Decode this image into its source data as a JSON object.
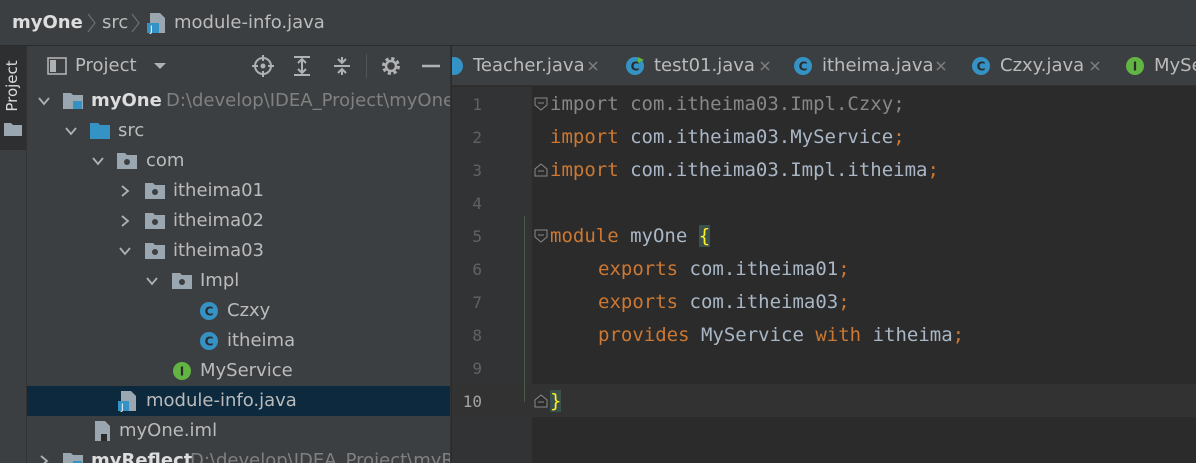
{
  "breadcrumb": {
    "project": "myOne",
    "folder": "src",
    "file": "module-info.java"
  },
  "toolstrip": {
    "project_label": "Project"
  },
  "panel": {
    "title": "Project"
  },
  "tree": [
    {
      "label": "myOne",
      "path": "D:\\develop\\IDEA_Project\\myOne",
      "icon": "module-folder-icon"
    },
    {
      "label": "src",
      "icon": "source-folder-icon"
    },
    {
      "label": "com",
      "icon": "package-icon"
    },
    {
      "label": "itheima01",
      "icon": "package-icon"
    },
    {
      "label": "itheima02",
      "icon": "package-icon"
    },
    {
      "label": "itheima03",
      "icon": "package-icon"
    },
    {
      "label": "Impl",
      "icon": "package-icon"
    },
    {
      "label": "Czxy",
      "icon": "class-icon"
    },
    {
      "label": "itheima",
      "icon": "class-icon"
    },
    {
      "label": "MyService",
      "icon": "interface-icon"
    },
    {
      "label": "module-info.java",
      "icon": "java-file-icon"
    },
    {
      "label": "myOne.iml",
      "icon": "iml-file-icon"
    },
    {
      "label": "myReflect",
      "path": "D:\\develop\\IDEA_Project\\myRe",
      "icon": "module-folder-icon"
    }
  ],
  "tabs": [
    {
      "label": "Teacher.java",
      "icon": "class-icon"
    },
    {
      "label": "test01.java",
      "icon": "class-icon"
    },
    {
      "label": "itheima.java",
      "icon": "class-icon"
    },
    {
      "label": "Czxy.java",
      "icon": "class-icon"
    },
    {
      "label": "MySe",
      "icon": "interface-icon"
    }
  ],
  "editor": {
    "line_numbers": [
      "1",
      "2",
      "3",
      "4",
      "5",
      "6",
      "7",
      "8",
      "9",
      "10"
    ],
    "lines": {
      "l1_kw": "import",
      "l1_rest": " com.itheima03.Impl.Czxy",
      "l1_end": ";",
      "l2_kw": "import",
      "l2_rest": " com.itheima03.MyService",
      "l2_end": ";",
      "l3_kw": "import",
      "l3_rest": " com.itheima03.Impl.itheima",
      "l3_end": ";",
      "l5_kw": "module",
      "l5_rest": " myOne ",
      "l5_brace": "{",
      "l6_kw": "exports",
      "l6_rest": " com.itheima01",
      "l6_end": ";",
      "l7_kw": "exports",
      "l7_rest": " com.itheima03",
      "l7_end": ";",
      "l8_kw": "provides",
      "l8_mid": " MyService ",
      "l8_kw2": "with",
      "l8_rest": " itheima",
      "l8_end": ";",
      "l10_brace": "}"
    }
  },
  "colors": {
    "keyword": "#cc7832",
    "text": "#a9b7c6",
    "selection": "#0d293e",
    "panel": "#3c3f41",
    "editor": "#2b2b2b"
  }
}
